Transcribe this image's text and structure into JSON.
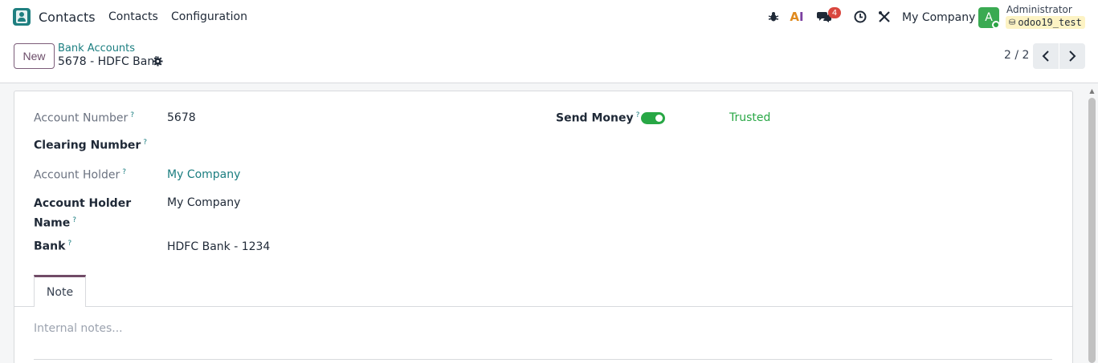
{
  "navbar": {
    "app_name": "Contacts",
    "menu": [
      "Contacts",
      "Configuration"
    ],
    "chat_count": "4",
    "ai_label_a": "A",
    "ai_label_i": "I",
    "company": "My Company",
    "avatar_letter": "A",
    "user_name": "Administrator",
    "database": "odoo19_test"
  },
  "control": {
    "new_label": "New",
    "breadcrumb_parent": "Bank Accounts",
    "breadcrumb_current": "5678 - HDFC Bank",
    "pager": "2 / 2"
  },
  "form": {
    "account_number_label": "Account Number",
    "account_number_value": "5678",
    "clearing_number_label": "Clearing Number",
    "account_holder_label": "Account Holder",
    "account_holder_value": "My Company",
    "account_holder_name_label": "Account Holder Name",
    "account_holder_name_value": "My Company",
    "bank_label": "Bank",
    "bank_value": "HDFC Bank - 1234",
    "send_money_label": "Send Money",
    "send_money_enabled": true,
    "send_money_status": "Trusted",
    "help_mark": "?"
  },
  "tabs": {
    "note_label": "Note",
    "notes_placeholder": "Internal notes..."
  },
  "colors": {
    "brand": "#714b67",
    "link": "#1b7e80",
    "success": "#28a745",
    "badge": "#d9463e"
  }
}
